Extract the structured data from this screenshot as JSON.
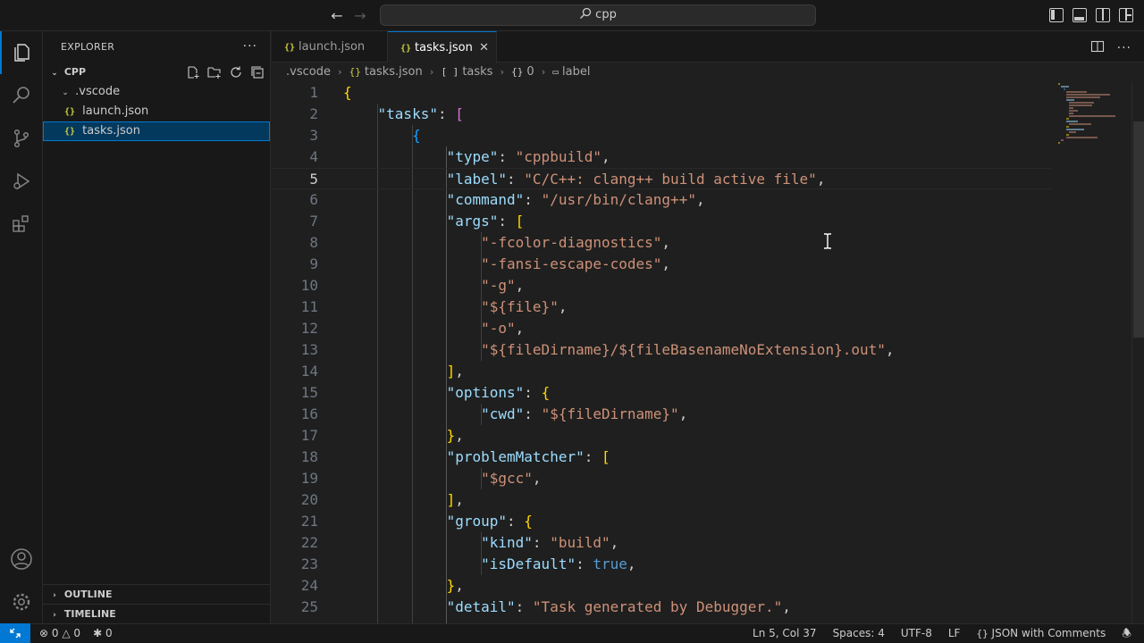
{
  "titlebar": {
    "search_text": "cpp"
  },
  "explorer": {
    "title": "EXPLORER",
    "folder_name": "CPP",
    "tree": [
      {
        "label": ".vscode",
        "type": "folder"
      },
      {
        "label": "launch.json",
        "type": "file"
      },
      {
        "label": "tasks.json",
        "type": "file",
        "selected": true
      }
    ],
    "outline_label": "OUTLINE",
    "timeline_label": "TIMELINE"
  },
  "tabs": [
    {
      "label": "launch.json",
      "active": false
    },
    {
      "label": "tasks.json",
      "active": true
    }
  ],
  "breadcrumb": {
    "items": [
      ".vscode",
      "tasks.json",
      "tasks",
      "0",
      "label"
    ],
    "icons": [
      "",
      "{}",
      "[ ]",
      "{}",
      "label-icon"
    ]
  },
  "code_lines": [
    "1",
    "2",
    "3",
    "4",
    "5",
    "6",
    "7",
    "8",
    "9",
    "10",
    "11",
    "12",
    "13",
    "14",
    "15",
    "16",
    "17",
    "18",
    "19",
    "20",
    "21",
    "22",
    "23",
    "24",
    "25"
  ],
  "code": {
    "tasks_key": "\"tasks\"",
    "type_key": "\"type\"",
    "type_val": "\"cppbuild\"",
    "label_key": "\"label\"",
    "label_val": "\"C/C++: clang++ build active file\"",
    "command_key": "\"command\"",
    "command_val": "\"/usr/bin/clang++\"",
    "args_key": "\"args\"",
    "arg1": "\"-fcolor-diagnostics\"",
    "arg2": "\"-fansi-escape-codes\"",
    "arg3": "\"-g\"",
    "arg4": "\"${file}\"",
    "arg5": "\"-o\"",
    "arg6": "\"${fileDirname}/${fileBasenameNoExtension}.out\"",
    "options_key": "\"options\"",
    "cwd_key": "\"cwd\"",
    "cwd_val": "\"${fileDirname}\"",
    "problemMatcher_key": "\"problemMatcher\"",
    "gcc_val": "\"$gcc\"",
    "group_key": "\"group\"",
    "kind_key": "\"kind\"",
    "kind_val": "\"build\"",
    "isDefault_key": "\"isDefault\"",
    "isDefault_val": "true",
    "detail_key": "\"detail\"",
    "detail_val": "\"Task generated by Debugger.\""
  },
  "current_line": 5,
  "statusbar": {
    "errors": "0",
    "warnings": "0",
    "ports": "0",
    "cursor": "Ln 5, Col 37",
    "spaces": "Spaces: 4",
    "encoding": "UTF-8",
    "eol": "LF",
    "language": "JSON with Comments"
  },
  "colors": {
    "accent": "#0078d4",
    "bracket1": "#ffd700",
    "bracket2": "#da70d6",
    "bracket3": "#179fff",
    "string": "#ce9178",
    "key": "#9cdcfe"
  }
}
